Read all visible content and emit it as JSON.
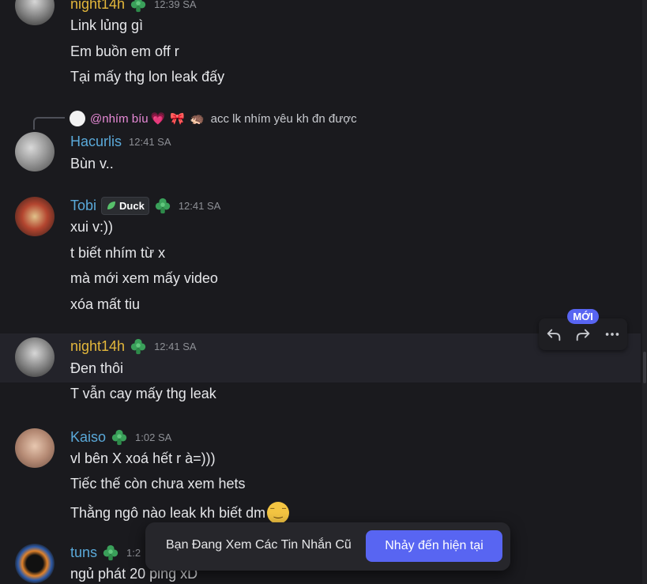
{
  "colors": {
    "background": "#1a1a1e",
    "accent": "#5865f2",
    "username_gold": "#e3b73b",
    "username_blue": "#5aa9d9",
    "username_pink": "#e88ad7",
    "badge_green": "#3aa05a"
  },
  "messages": [
    {
      "username": "night14h",
      "timestamp": "12:39 SA",
      "lines": [
        "Link lủng gì",
        "Em buồn em off r",
        "Tại mấy thg lon leak đấy"
      ]
    },
    {
      "username": "Hacurlis",
      "timestamp": "12:41 SA",
      "reply": {
        "mention": "@nhím bíu",
        "text": "acc lk nhím yêu kh đn được"
      },
      "lines": [
        "Bùn v.."
      ]
    },
    {
      "username": "Tobi",
      "tag": "Duck",
      "timestamp": "12:41 SA",
      "lines": [
        "xui v:))",
        "t biết nhím từ x",
        "mà mới xem mấy video",
        "xóa mất tiu"
      ]
    },
    {
      "username": "night14h",
      "timestamp": "12:41 SA",
      "lines": [
        "Đen thôi",
        "T vẫn cay mấy thg leak"
      ]
    },
    {
      "username": "Kaiso",
      "timestamp": "1:02 SA",
      "lines": [
        "vl bên X xoá hết r à=)))",
        "Tiếc thế còn chưa xem hets",
        "Thằng ngô nào leak kh biết dm"
      ]
    },
    {
      "username": "tuns",
      "timestamp": "1:2",
      "lines": [
        "ngủ phát 20 ping xD"
      ]
    }
  ],
  "toolbar": {
    "new_label": "MỚI",
    "icons": [
      "reply-icon",
      "forward-icon",
      "more-icon"
    ]
  },
  "jumpbar": {
    "text": "Bạn Đang Xem Các Tin Nhắn Cũ",
    "button": "Nhảy đến hiện tại"
  }
}
